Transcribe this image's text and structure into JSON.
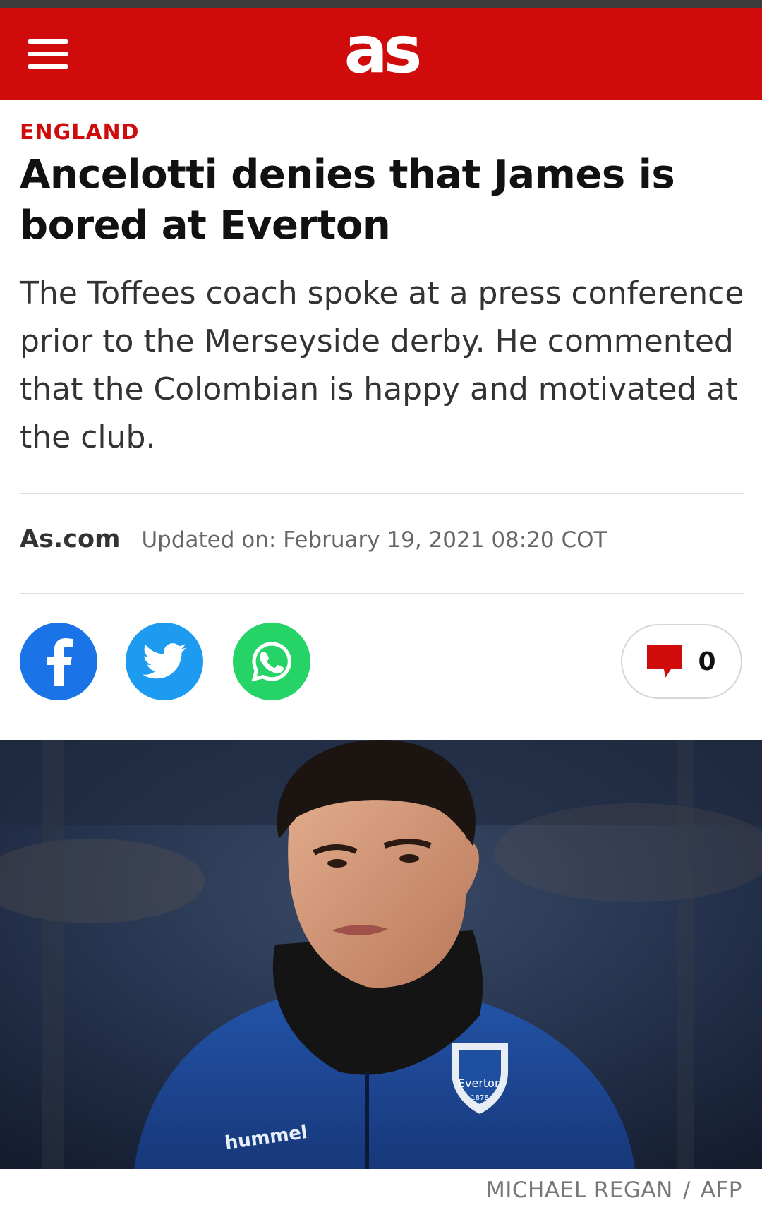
{
  "header": {
    "logo_text": "as",
    "brand_color": "#cf0b0b"
  },
  "article": {
    "section": "ENGLAND",
    "title": "Ancelotti denies that James is bored at Everton",
    "subtitle": "The Toffees coach spoke at a press conference prior to the Merseyside derby. He commented that the Colombian is happy and motivated at the club.",
    "author": "As.com",
    "updated": "Updated on: February 19, 2021 08:20 COT"
  },
  "share": {
    "icons": [
      "facebook-icon",
      "twitter-icon",
      "whatsapp-icon"
    ],
    "colors": {
      "facebook": "#1b73e8",
      "twitter": "#1d9bf0",
      "whatsapp": "#25d366"
    }
  },
  "comments": {
    "count": "0",
    "icon": "comment-bubble-icon"
  },
  "photo": {
    "shirt_brand": "hummel",
    "crest_text": "Everton",
    "crest_year": "1878",
    "credit_photographer": "MICHAEL REGAN",
    "credit_separator": "/",
    "credit_agency": "AFP"
  }
}
